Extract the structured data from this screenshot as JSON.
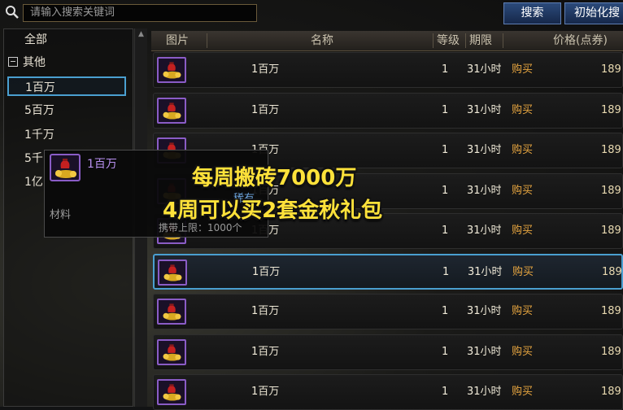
{
  "search": {
    "placeholder": "请输入搜索关键词",
    "button": "搜索",
    "reset_button": "初始化搜"
  },
  "sidebar": {
    "items": [
      {
        "label": "全部"
      },
      {
        "label": "其他"
      },
      {
        "label": "1百万"
      },
      {
        "label": "5百万"
      },
      {
        "label": "1千万"
      },
      {
        "label": "5千"
      },
      {
        "label": "1亿"
      }
    ]
  },
  "table": {
    "headers": {
      "image": "图片",
      "name": "名称",
      "level": "等级",
      "duration": "期限",
      "price": "价格(点券)"
    },
    "rows": [
      {
        "name": "1百万",
        "level": "1",
        "duration": "31小时",
        "action": "购买",
        "price": "189"
      },
      {
        "name": "1百万",
        "level": "1",
        "duration": "31小时",
        "action": "购买",
        "price": "189"
      },
      {
        "name": "1百万",
        "level": "1",
        "duration": "31小时",
        "action": "购买",
        "price": "189"
      },
      {
        "name": "1百万",
        "level": "1",
        "duration": "31小时",
        "action": "购买",
        "price": "189"
      },
      {
        "name": "1百万",
        "level": "1",
        "duration": "31小时",
        "action": "购买",
        "price": "189"
      },
      {
        "name": "1百万",
        "level": "1",
        "duration": "31小时",
        "action": "购买",
        "price": "189"
      },
      {
        "name": "1百万",
        "level": "1",
        "duration": "31小时",
        "action": "购买",
        "price": "189"
      },
      {
        "name": "1百万",
        "level": "1",
        "duration": "31小时",
        "action": "购买",
        "price": "189"
      },
      {
        "name": "1百万",
        "level": "1",
        "duration": "31小时",
        "action": "购买",
        "price": "189"
      }
    ],
    "selected_row": 5
  },
  "tooltip": {
    "name": "1百万",
    "rarity": "稀有",
    "type": "材料",
    "limit": "携带上限：1000个"
  },
  "caption": {
    "line1": "每周搬砖7000万",
    "line2": "4周可以买2套金秋礼包"
  },
  "colors": {
    "accent": "#4a9fd0",
    "buy": "#e8a640",
    "caption": "#ffe23a",
    "rare_border": "#8a5cc6"
  }
}
